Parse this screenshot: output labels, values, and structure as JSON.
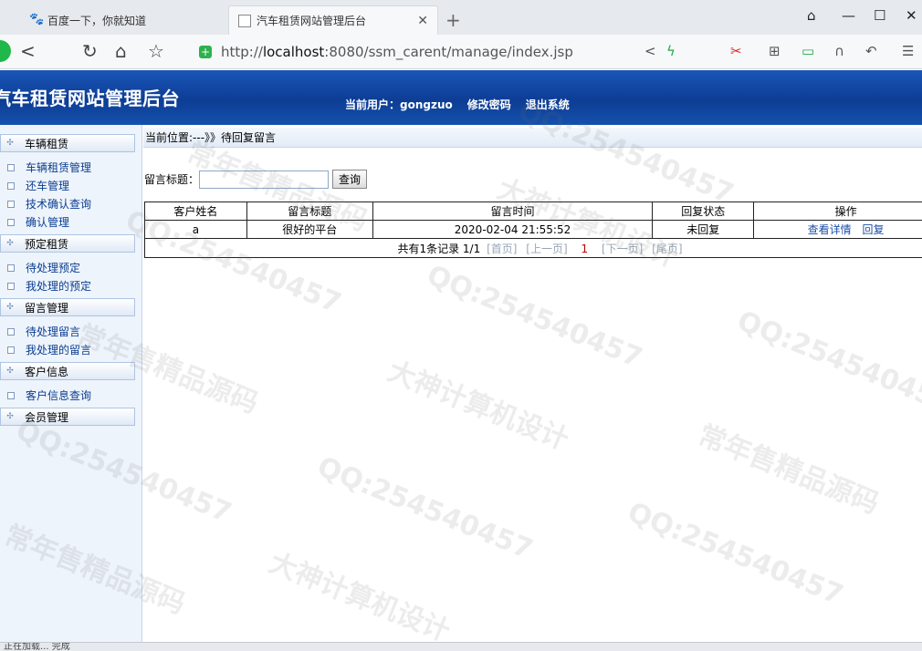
{
  "browser": {
    "tabs": [
      {
        "label": "百度一下，你就知道",
        "active": false
      },
      {
        "label": "汽车租赁网站管理后台",
        "active": true
      }
    ],
    "url_prefix": "http://",
    "url_host": "localhost",
    "url_rest": ":8080/ssm_carent/manage/index.jsp"
  },
  "header": {
    "title": "汽车租赁网站管理后台",
    "current_user": "当前用户：gongzuo",
    "change_password": "修改密码",
    "logout": "退出系统"
  },
  "sidebar": {
    "groups": [
      {
        "label": "车辆租赁",
        "items": [
          "车辆租赁管理",
          "还车管理",
          "技术确认查询",
          "确认管理"
        ]
      },
      {
        "label": "预定租赁",
        "items": [
          "待处理预定",
          "我处理的预定"
        ]
      },
      {
        "label": "留言管理",
        "items": [
          "待处理留言",
          "我处理的留言"
        ]
      },
      {
        "label": "客户信息",
        "items": [
          "客户信息查询"
        ]
      },
      {
        "label": "会员管理",
        "items": []
      }
    ]
  },
  "main": {
    "breadcrumb": "当前位置:---》》待回复留言",
    "search_label": "留言标题：",
    "search_value": "",
    "search_button": "查询",
    "table": {
      "headers": [
        "客户姓名",
        "留言标题",
        "留言时间",
        "回复状态",
        "操作"
      ],
      "rows": [
        {
          "name": "a",
          "title": "很好的平台",
          "time": "2020-02-04 21:55:52",
          "status": "未回复",
          "ops": [
            "查看详情",
            "回复"
          ]
        }
      ]
    },
    "pager": {
      "summary": "共有1条记录  1/1",
      "first": "[首页]",
      "prev": "[上一页]",
      "current": "1",
      "next": "[下一页]",
      "last": "[尾页]"
    }
  },
  "watermarks": [
    "QQ:254540457",
    "常年售精品源码",
    "大神计算机设计"
  ],
  "statusbar": "正在加载... 完成"
}
